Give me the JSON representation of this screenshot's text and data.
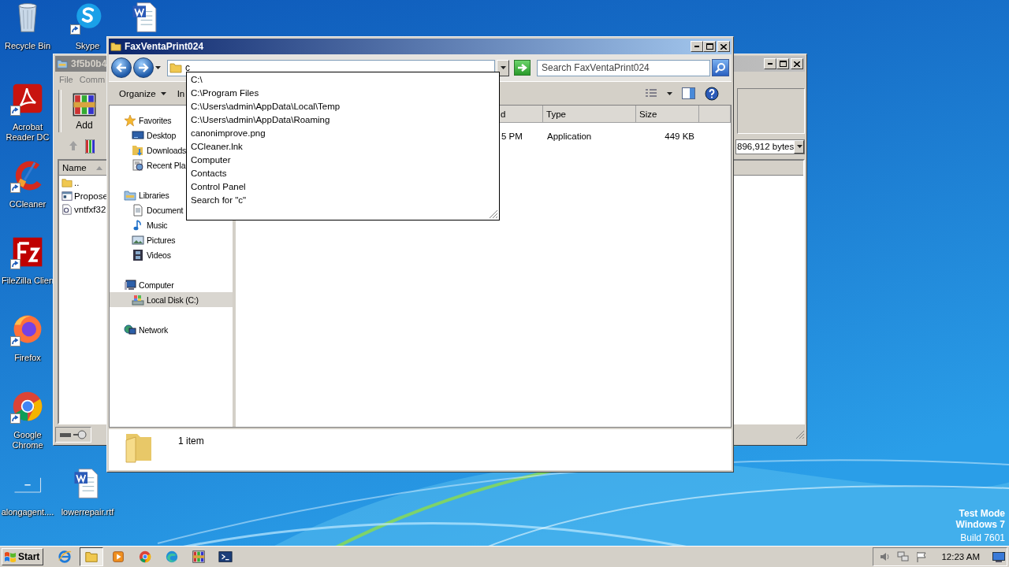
{
  "desktop_icons": [
    {
      "kind": "recycle",
      "label": "Recycle Bin",
      "shortcut": false
    },
    {
      "kind": "skype",
      "label": "Skype",
      "shortcut": true
    },
    {
      "kind": "word",
      "shortcut": false
    },
    {
      "kind": "acrobat",
      "label": "Acrobat Reader DC",
      "shortcut": true
    },
    {
      "kind": "ccleaner",
      "label": "CCleaner",
      "shortcut": true
    },
    {
      "kind": "filezilla",
      "label": "FileZilla Clien",
      "shortcut": true
    },
    {
      "kind": "firefox",
      "label": "Firefox",
      "shortcut": true
    },
    {
      "kind": "chrome",
      "label": "Google Chrome",
      "shortcut": true
    },
    {
      "kind": "blank",
      "label": "alongagent....",
      "shortcut": false
    },
    {
      "kind": "word",
      "label": "lowerrepair.rtf",
      "shortcut": false
    }
  ],
  "back_window": {
    "title": "3f5b0b4",
    "menu": [
      "File",
      "Comm"
    ],
    "toolbar": [
      {
        "label": "Add"
      }
    ],
    "size_box": "896,912 bytes",
    "columns": [
      {
        "label": "Name",
        "sorted": true
      }
    ],
    "rows": [
      {
        "kind": "folder",
        "name": ".."
      },
      {
        "kind": "doc",
        "name": "Propose"
      },
      {
        "kind": "exe",
        "name": "vntfxf32"
      }
    ]
  },
  "window": {
    "title": "FaxVentaPrint024",
    "address": "c",
    "search": {
      "placeholder": "Search FaxVentaPrint024"
    },
    "toolbar": [
      {
        "label": "Organize",
        "menu": true
      },
      {
        "label": "In",
        "menu": false
      }
    ],
    "nav": [
      {
        "kind": "favorites",
        "label": "Favorites",
        "selected": false,
        "children": [
          {
            "kind": "desktop",
            "label": "Desktop",
            "selected": false
          },
          {
            "kind": "downloads",
            "label": "Downloads",
            "selected": false
          },
          {
            "kind": "recent",
            "label": "Recent Pla",
            "selected": false
          }
        ]
      },
      {
        "kind": "libraries",
        "label": "Libraries",
        "selected": false,
        "children": [
          {
            "kind": "documents",
            "label": "Document",
            "selected": false
          },
          {
            "kind": "music",
            "label": "Music",
            "selected": false
          },
          {
            "kind": "pictures",
            "label": "Pictures",
            "selected": false
          },
          {
            "kind": "videos",
            "label": "Videos",
            "selected": false
          }
        ]
      },
      {
        "kind": "computer",
        "label": "Computer",
        "selected": false,
        "children": [
          {
            "kind": "disk",
            "label": "Local Disk (C:)",
            "selected": true
          }
        ]
      },
      {
        "kind": "network",
        "label": "Network",
        "selected": false
      }
    ],
    "columns": [
      {
        "label": "d"
      },
      {
        "label": "Type"
      },
      {
        "label": "Size"
      }
    ],
    "rows": [
      {
        "cells": [
          "5 PM",
          "Application",
          "449 KB"
        ]
      }
    ],
    "details": {
      "count": "1 item"
    }
  },
  "autocomplete": {
    "items": [
      "C:\\",
      "C:\\Program Files",
      "C:\\Users\\admin\\AppData\\Local\\Temp",
      "C:\\Users\\admin\\AppData\\Roaming",
      "canonimprove.png",
      "CCleaner.lnk",
      "Computer",
      "Contacts",
      "Control Panel",
      "Search for \"c\""
    ]
  },
  "taskbar": {
    "start": "Start",
    "apps": [
      {
        "kind": "ie",
        "active": false
      },
      {
        "kind": "explorer",
        "active": true
      },
      {
        "kind": "media",
        "active": false
      },
      {
        "kind": "chrome",
        "active": false
      },
      {
        "kind": "edge",
        "active": false
      },
      {
        "kind": "winrar",
        "active": false
      },
      {
        "kind": "powershell",
        "active": false
      }
    ],
    "clock": "12:23 AM"
  },
  "test_mode_notice": [
    "Test Mode",
    "Windows 7",
    "Build 7601"
  ]
}
